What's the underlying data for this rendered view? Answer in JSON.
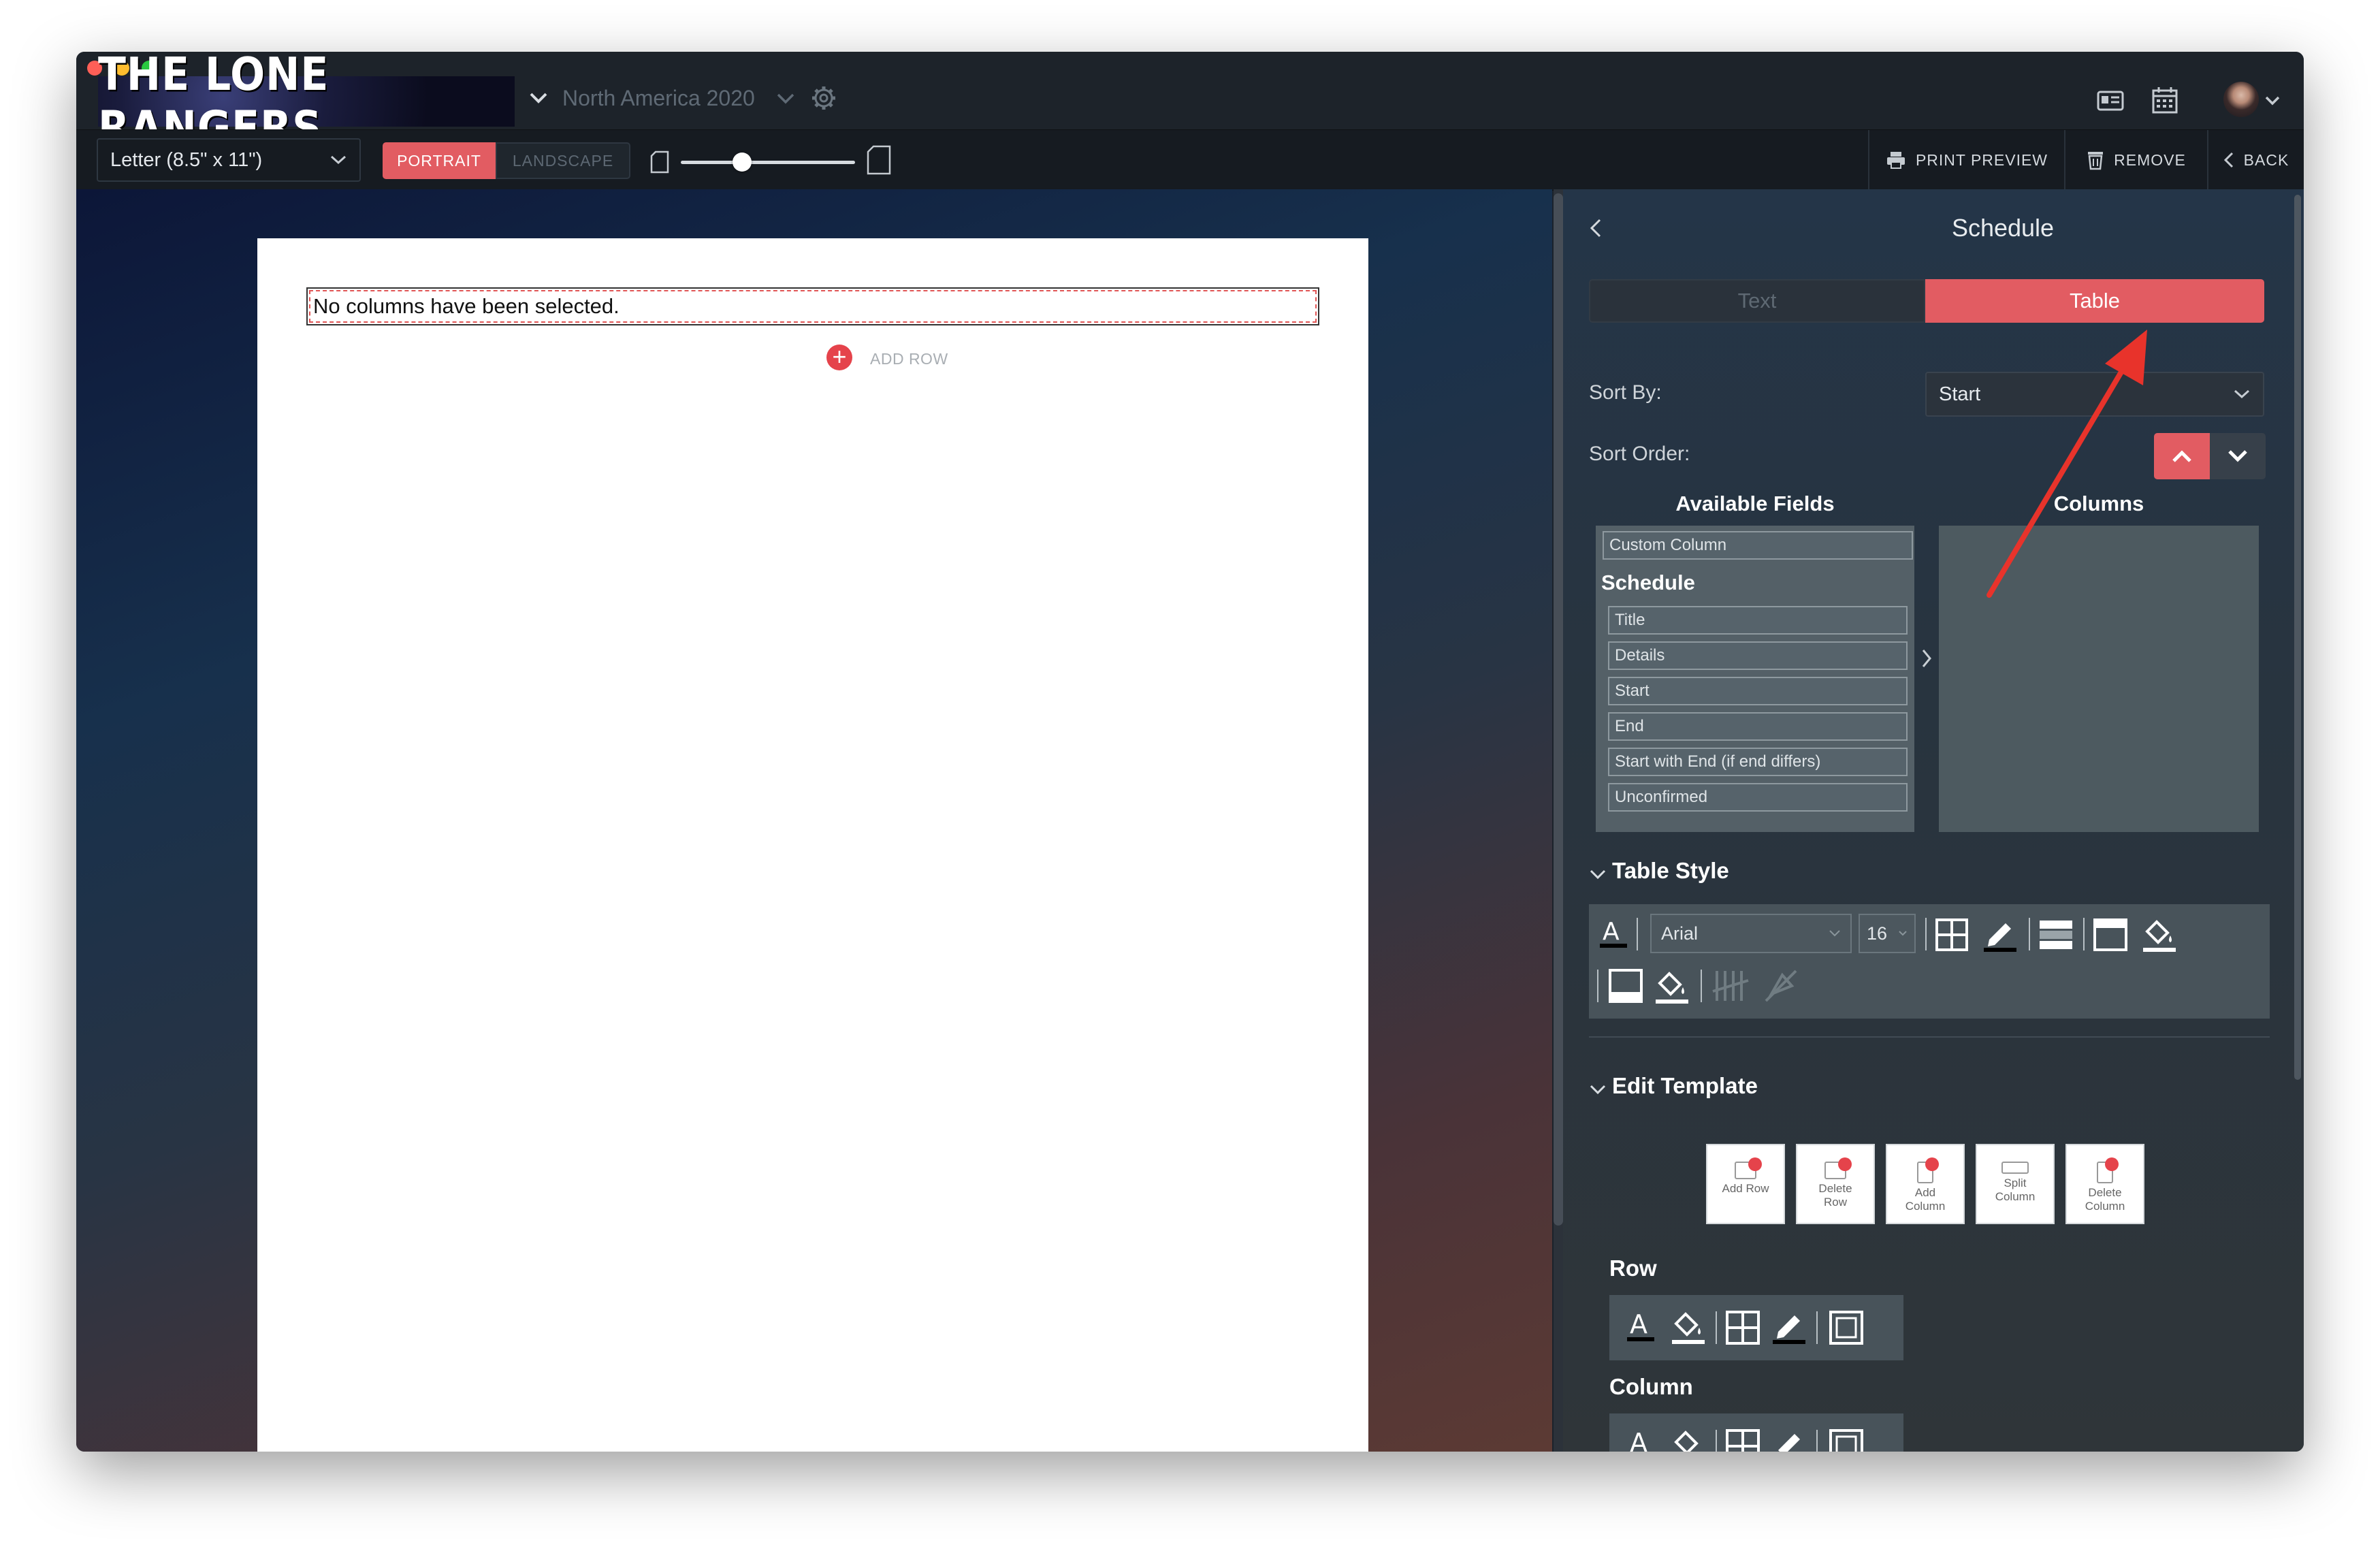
{
  "app": {
    "logo_text": "THE LONE RANGERS",
    "project_name": "North America 2020"
  },
  "toolbar": {
    "paper_size": "Letter (8.5\" x 11\")",
    "portrait_label": "PORTRAIT",
    "landscape_label": "LANDSCAPE",
    "zoom_level": 0.35,
    "print_preview_label": "PRINT PREVIEW",
    "remove_label": "REMOVE",
    "back_label": "BACK"
  },
  "document": {
    "message": "No columns have been selected.",
    "add_row_label": "ADD ROW"
  },
  "panel": {
    "title": "Schedule",
    "tabs": [
      "Text",
      "Table"
    ],
    "active_tab": "Table",
    "sort_by_label": "Sort By:",
    "sort_by_value": "Start",
    "sort_order_label": "Sort Order:",
    "available_fields_label": "Available Fields",
    "columns_label": "Columns",
    "custom_column": "Custom Column",
    "group_label": "Schedule",
    "fields": [
      "Title",
      "Details",
      "Start",
      "End",
      "Start with End (if end differs)",
      "Unconfirmed"
    ],
    "table_style_label": "Table Style",
    "font_name": "Arial",
    "font_size": "16",
    "edit_template_label": "Edit Template",
    "template_buttons": [
      {
        "line1": "Add Row",
        "line2": ""
      },
      {
        "line1": "Delete",
        "line2": "Row"
      },
      {
        "line1": "Add",
        "line2": "Column"
      },
      {
        "line1": "Split",
        "line2": "Column"
      },
      {
        "line1": "Delete",
        "line2": "Column"
      }
    ],
    "row_label": "Row",
    "column_label": "Column"
  },
  "colors": {
    "accent": "#e25c62",
    "annotation_arrow": "#e8332b"
  }
}
